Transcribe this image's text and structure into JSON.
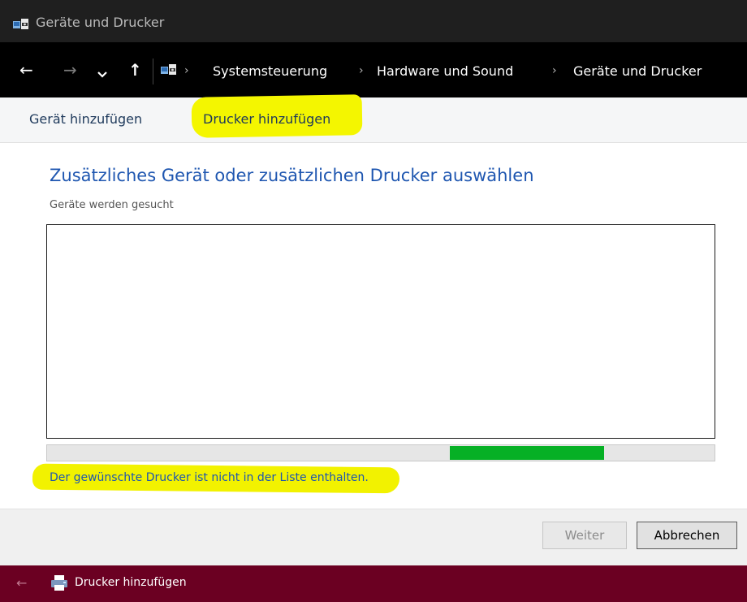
{
  "window": {
    "title": "Geräte und Drucker"
  },
  "address": {
    "back": "←",
    "forward": "→",
    "recent": "⌄",
    "up": "↑",
    "separator": "›",
    "crumbs": [
      "Systemsteuerung",
      "Hardware und Sound",
      "Geräte und Drucker"
    ]
  },
  "commands": {
    "add_device": "Gerät hinzufügen",
    "add_printer": "Drucker hinzufügen"
  },
  "main": {
    "heading": "Zusätzliches Gerät oder zusätzlichen Drucker auswählen",
    "status": "Geräte werden gesucht",
    "progress": {
      "start": 0.603,
      "end": 0.834
    },
    "not_listed_link": "Der gewünschte Drucker ist nicht in der Liste enthalten."
  },
  "buttons": {
    "next": "Weiter",
    "cancel": "Abbrechen"
  },
  "subwindow": {
    "back": "←",
    "title": "Drucker hinzufügen"
  },
  "colors": {
    "highlight": "#f4f600",
    "progress_fill": "#06b025",
    "link": "#1e56b0",
    "wizard_bar": "#6b0022"
  }
}
